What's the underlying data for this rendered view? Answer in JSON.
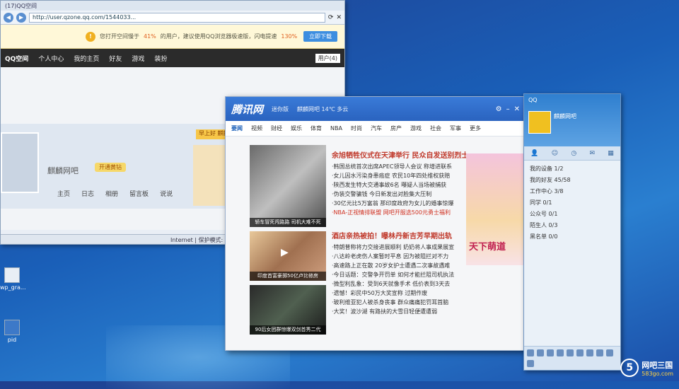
{
  "ie": {
    "tab": "(17)QQ空间",
    "url": "http://user.qzone.qq.com/1544033...",
    "notice": {
      "text_a": "您打开空间慢于",
      "pct_a": "41%",
      "text_b": "的用户，建议使用QQ浏览器极速版，闪电提速",
      "pct_b": "130%",
      "button": "立即下载"
    },
    "qz_nav": [
      "QQ空间",
      "个人中心",
      "我的主页",
      "好友",
      "游戏",
      "装扮"
    ],
    "qz_chip": "用户(4)",
    "profile_name": "麒麟网吧",
    "open_vip": "开通黄钻",
    "morning": "早上好 麒麟网吧",
    "tabs": [
      "主页",
      "日志",
      "相册",
      "留言板",
      "说说"
    ],
    "status": "Internet | 保护模式: 禁用"
  },
  "desktop": {
    "icons": [
      "wp_gra...",
      "pid"
    ]
  },
  "tencent": {
    "logo": "腾讯网",
    "sub": "迷你版",
    "weather": "麒麟网吧 14℃ 多云",
    "menu": [
      "要闻",
      "视频",
      "财经",
      "娱乐",
      "体育",
      "NBA",
      "时尚",
      "汽车",
      "房产",
      "游戏",
      "社会",
      "军事",
      "更多"
    ],
    "photos": [
      {
        "cap": "轿车冒死闯路路 司机大难不死"
      },
      {
        "cap": "印度首富豪掷50亿卢比修房"
      },
      {
        "cap": "90后女团群惊爆双剑首秀二代"
      }
    ],
    "block1": {
      "headline": "余旭牺牲仪式在天津举行 民众自发送别烈士",
      "items": [
        "·韩国总统首次出席APEC领导人会议 称增进联系",
        "·女儿因水污染身患癌症 农民10年四处维权获赔",
        "·陕西发生特大交通事故6名 曝疑人当场被捕获",
        "·伪装交警骗钱 今日新发出对脸集大压制",
        "·30亿元比5万富翁 那印度政府为女儿的婚事惊爆",
        "·NBA-正视情排联盟 网吧开服选500元勇士福利"
      ]
    },
    "block2": {
      "headline": "酒店亲热被拍！曝林丹新吉芳早期出轨",
      "items": [
        "·特朗普称将力交接进展顺利 奶奶将人事成果展宣",
        "·八达岭老虎伤人案暂时平息 因为被阻拦对不力",
        "·高速路上正在散 20岁女护士遭遇二次事故遇难",
        "·今日话题：交警争开罚单 如何才能拦阻司机执法",
        "·微型利乱象：受到6天就像手术 低价表到3天去",
        "·遗憾！彩民中50万大奖宣称 过期作废",
        "·玻利维亚犯人被杀身丧事 群众痛痛犯罚耳首脑",
        "·大奖！波沙湖 有路扶的大雪日轻便遭遭弱"
      ]
    },
    "ad_text": "天下萌道"
  },
  "qq": {
    "title": "QQ",
    "nickname": "麒麟网吧",
    "groups": [
      "我的设备 1/2",
      "我的好友 45/58",
      "工作中心 3/8",
      "同学 0/1",
      "公众号 0/1",
      "陌生人 0/3",
      "黑名单 0/0"
    ]
  },
  "watermark": {
    "logo": "5",
    "title": "网吧三国",
    "url": "583go.com"
  }
}
